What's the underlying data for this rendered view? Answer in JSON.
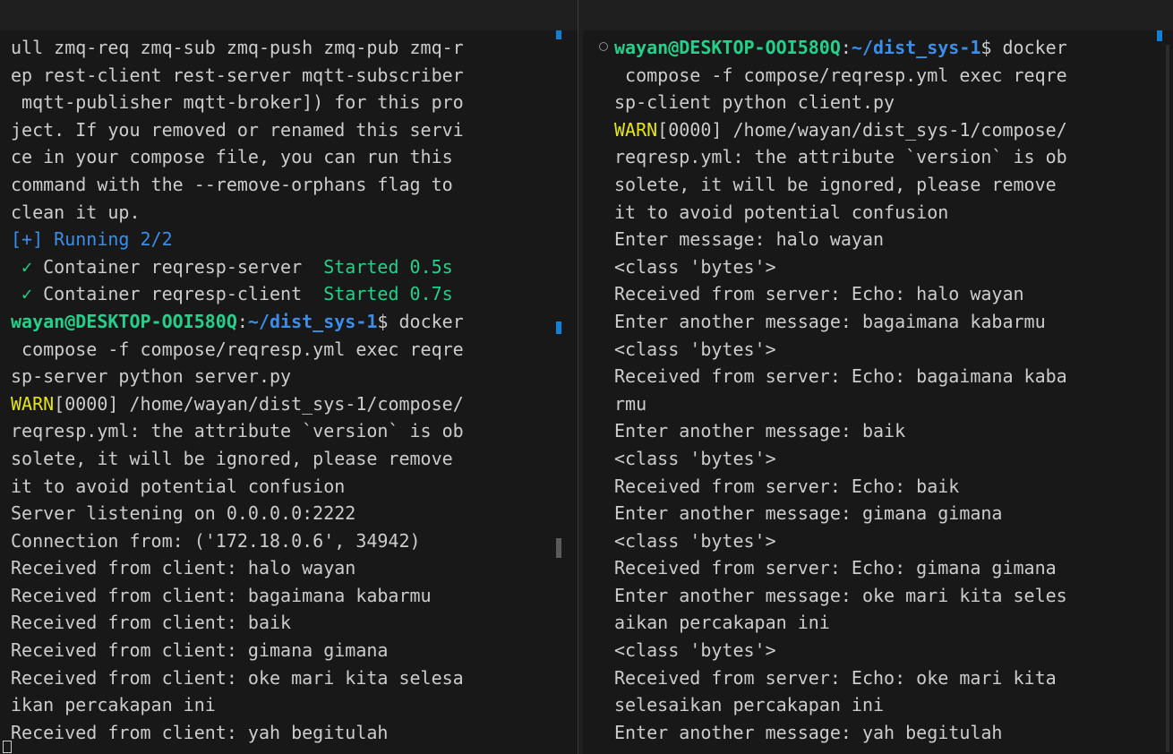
{
  "left_terminal": {
    "lines": [
      {
        "parts": [
          {
            "t": "ull zmq-req zmq-sub zmq-push zmq-pub zmq-r",
            "c": "white"
          }
        ]
      },
      {
        "parts": [
          {
            "t": "ep rest-client rest-server mqtt-subscriber",
            "c": "white"
          }
        ]
      },
      {
        "parts": [
          {
            "t": " mqtt-publisher mqtt-broker]) for this pro",
            "c": "white"
          }
        ]
      },
      {
        "parts": [
          {
            "t": "ject. If you removed or renamed this servi",
            "c": "white"
          }
        ]
      },
      {
        "parts": [
          {
            "t": "ce in your compose file, you can run this ",
            "c": "white"
          }
        ]
      },
      {
        "parts": [
          {
            "t": "command with the --remove-orphans flag to ",
            "c": "white"
          }
        ]
      },
      {
        "parts": [
          {
            "t": "clean it up.",
            "c": "white"
          }
        ]
      },
      {
        "parts": [
          {
            "t": "[+] Running 2/2",
            "c": "blue"
          }
        ]
      },
      {
        "parts": [
          {
            "t": " ✓ ",
            "c": "green"
          },
          {
            "t": "Container reqresp-server  ",
            "c": "white"
          },
          {
            "t": "Started 0.5s",
            "c": "green"
          }
        ]
      },
      {
        "parts": [
          {
            "t": " ✓ ",
            "c": "green"
          },
          {
            "t": "Container reqresp-client  ",
            "c": "white"
          },
          {
            "t": "Started 0.7s",
            "c": "green"
          }
        ]
      },
      {
        "parts": [
          {
            "t": "wayan@DESKTOP-OOI580Q",
            "c": "user"
          },
          {
            "t": ":",
            "c": "white"
          },
          {
            "t": "~/dist_sys-1",
            "c": "path"
          },
          {
            "t": "$ docker",
            "c": "white"
          }
        ]
      },
      {
        "parts": [
          {
            "t": " compose -f compose/reqresp.yml exec reqre",
            "c": "white"
          }
        ]
      },
      {
        "parts": [
          {
            "t": "sp-server python server.py",
            "c": "white"
          }
        ]
      },
      {
        "parts": [
          {
            "t": "WARN",
            "c": "warn"
          },
          {
            "t": "[0000] /home/wayan/dist_sys-1/compose/",
            "c": "white"
          }
        ]
      },
      {
        "parts": [
          {
            "t": "reqresp.yml: the attribute `version` is ob",
            "c": "white"
          }
        ]
      },
      {
        "parts": [
          {
            "t": "solete, it will be ignored, please remove ",
            "c": "white"
          }
        ]
      },
      {
        "parts": [
          {
            "t": "it to avoid potential confusion",
            "c": "white"
          }
        ]
      },
      {
        "parts": [
          {
            "t": "Server listening on 0.0.0.0:2222",
            "c": "white"
          }
        ]
      },
      {
        "parts": [
          {
            "t": "Connection from: ('172.18.0.6', 34942)",
            "c": "white"
          }
        ]
      },
      {
        "parts": [
          {
            "t": "Received from client: halo wayan",
            "c": "white"
          }
        ]
      },
      {
        "parts": [
          {
            "t": "Received from client: bagaimana kabarmu",
            "c": "white"
          }
        ]
      },
      {
        "parts": [
          {
            "t": "Received from client: baik",
            "c": "white"
          }
        ]
      },
      {
        "parts": [
          {
            "t": "Received from client: gimana gimana",
            "c": "white"
          }
        ]
      },
      {
        "parts": [
          {
            "t": "Received from client: oke mari kita selesa",
            "c": "white"
          }
        ]
      },
      {
        "parts": [
          {
            "t": "ikan percakapan ini",
            "c": "white"
          }
        ]
      },
      {
        "parts": [
          {
            "t": "Received from client: yah begitulah",
            "c": "white"
          }
        ]
      }
    ]
  },
  "right_terminal": {
    "lines": [
      {
        "parts": [
          {
            "t": "wayan@DESKTOP-OOI580Q",
            "c": "user"
          },
          {
            "t": ":",
            "c": "white"
          },
          {
            "t": "~/dist_sys-1",
            "c": "path"
          },
          {
            "t": "$ docker",
            "c": "white"
          }
        ]
      },
      {
        "parts": [
          {
            "t": " compose -f compose/reqresp.yml exec reqre",
            "c": "white"
          }
        ]
      },
      {
        "parts": [
          {
            "t": "sp-client python client.py",
            "c": "white"
          }
        ]
      },
      {
        "parts": [
          {
            "t": "WARN",
            "c": "warn"
          },
          {
            "t": "[0000] /home/wayan/dist_sys-1/compose/",
            "c": "white"
          }
        ]
      },
      {
        "parts": [
          {
            "t": "reqresp.yml: the attribute `version` is ob",
            "c": "white"
          }
        ]
      },
      {
        "parts": [
          {
            "t": "solete, it will be ignored, please remove ",
            "c": "white"
          }
        ]
      },
      {
        "parts": [
          {
            "t": "it to avoid potential confusion",
            "c": "white"
          }
        ]
      },
      {
        "parts": [
          {
            "t": "Enter message: halo wayan",
            "c": "white"
          }
        ]
      },
      {
        "parts": [
          {
            "t": "<class 'bytes'>",
            "c": "white"
          }
        ]
      },
      {
        "parts": [
          {
            "t": "Received from server: Echo: halo wayan",
            "c": "white"
          }
        ]
      },
      {
        "parts": [
          {
            "t": "Enter another message: bagaimana kabarmu",
            "c": "white"
          }
        ]
      },
      {
        "parts": [
          {
            "t": "<class 'bytes'>",
            "c": "white"
          }
        ]
      },
      {
        "parts": [
          {
            "t": "Received from server: Echo: bagaimana kaba",
            "c": "white"
          }
        ]
      },
      {
        "parts": [
          {
            "t": "rmu",
            "c": "white"
          }
        ]
      },
      {
        "parts": [
          {
            "t": "Enter another message: baik",
            "c": "white"
          }
        ]
      },
      {
        "parts": [
          {
            "t": "<class 'bytes'>",
            "c": "white"
          }
        ]
      },
      {
        "parts": [
          {
            "t": "Received from server: Echo: baik",
            "c": "white"
          }
        ]
      },
      {
        "parts": [
          {
            "t": "Enter another message: gimana gimana",
            "c": "white"
          }
        ]
      },
      {
        "parts": [
          {
            "t": "<class 'bytes'>",
            "c": "white"
          }
        ]
      },
      {
        "parts": [
          {
            "t": "Received from server: Echo: gimana gimana",
            "c": "white"
          }
        ]
      },
      {
        "parts": [
          {
            "t": "Enter another message: oke mari kita seles",
            "c": "white"
          }
        ]
      },
      {
        "parts": [
          {
            "t": "aikan percakapan ini",
            "c": "white"
          }
        ]
      },
      {
        "parts": [
          {
            "t": "<class 'bytes'>",
            "c": "white"
          }
        ]
      },
      {
        "parts": [
          {
            "t": "Received from server: Echo: oke mari kita ",
            "c": "white"
          }
        ]
      },
      {
        "parts": [
          {
            "t": "selesaikan percakapan ini",
            "c": "white"
          }
        ]
      },
      {
        "parts": [
          {
            "t": "Enter another message: yah begitulah",
            "c": "white"
          }
        ]
      }
    ]
  },
  "icons": {
    "command_status": "circle-icon",
    "cursor": "cursor-block-icon"
  },
  "colors": {
    "background": "#181818",
    "text": "#cccccc",
    "user": "#23d18b",
    "path": "#3b8eea",
    "warn": "#e5e510",
    "marker": "#0e80d6"
  }
}
